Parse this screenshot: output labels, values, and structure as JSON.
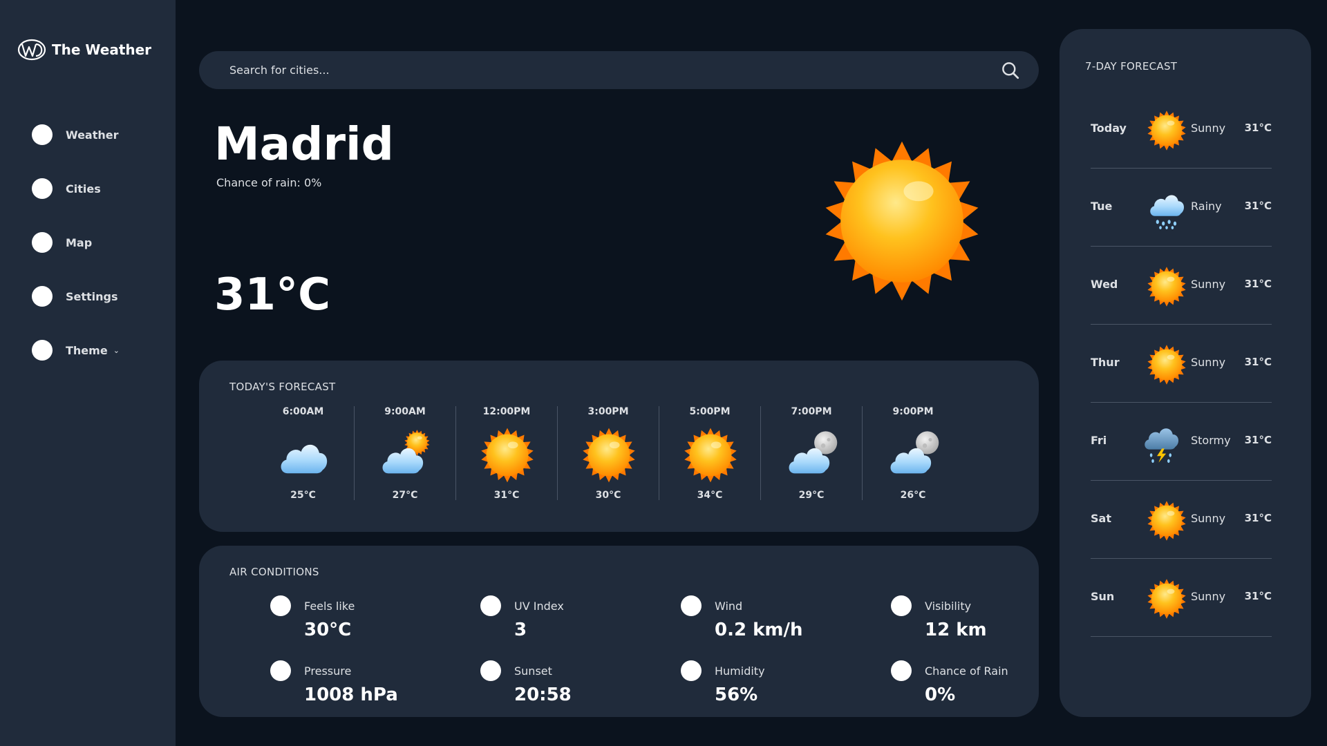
{
  "app": {
    "title": "The Weather",
    "logo_icon": "weather-logo-icon"
  },
  "sidebar": {
    "items": [
      {
        "label": "Weather"
      },
      {
        "label": "Cities"
      },
      {
        "label": "Map"
      },
      {
        "label": "Settings"
      },
      {
        "label": "Theme",
        "has_dropdown": true
      }
    ]
  },
  "search": {
    "placeholder": "Search for cities...",
    "value": ""
  },
  "current": {
    "city": "Madrid",
    "rain_chance": "Chance of rain: 0%",
    "temperature": "31°C",
    "icon": "sun-icon"
  },
  "today_forecast": {
    "title": "TODAY'S FORECAST",
    "hours": [
      {
        "time": "6:00AM",
        "temp": "25°C",
        "icon": "cloud-icon"
      },
      {
        "time": "9:00AM",
        "temp": "27°C",
        "icon": "partly-sunny-icon"
      },
      {
        "time": "12:00PM",
        "temp": "31°C",
        "icon": "sun-icon"
      },
      {
        "time": "3:00PM",
        "temp": "30°C",
        "icon": "sun-icon"
      },
      {
        "time": "5:00PM",
        "temp": "34°C",
        "icon": "sun-icon"
      },
      {
        "time": "7:00PM",
        "temp": "29°C",
        "icon": "cloud-moon-icon"
      },
      {
        "time": "9:00PM",
        "temp": "26°C",
        "icon": "cloud-moon-icon"
      }
    ]
  },
  "air_conditions": {
    "title": "AIR CONDITIONS",
    "metrics": [
      {
        "label": "Feels like",
        "value": "30°C"
      },
      {
        "label": "UV Index",
        "value": "3"
      },
      {
        "label": "Wind",
        "value": "0.2 km/h"
      },
      {
        "label": "Visibility",
        "value": "12 km"
      },
      {
        "label": "Pressure",
        "value": "1008 hPa"
      },
      {
        "label": "Sunset",
        "value": "20:58"
      },
      {
        "label": "Humidity",
        "value": "56%"
      },
      {
        "label": "Chance of Rain",
        "value": "0%"
      }
    ]
  },
  "week_forecast": {
    "title": "7-DAY FORECAST",
    "days": [
      {
        "day": "Today",
        "condition": "Sunny",
        "temp": "31°C",
        "icon": "sun-icon"
      },
      {
        "day": "Tue",
        "condition": "Rainy",
        "temp": "31°C",
        "icon": "rain-cloud-icon"
      },
      {
        "day": "Wed",
        "condition": "Sunny",
        "temp": "31°C",
        "icon": "sun-icon"
      },
      {
        "day": "Thur",
        "condition": "Sunny",
        "temp": "31°C",
        "icon": "sun-icon"
      },
      {
        "day": "Fri",
        "condition": "Stormy",
        "temp": "31°C",
        "icon": "storm-cloud-icon"
      },
      {
        "day": "Sat",
        "condition": "Sunny",
        "temp": "31°C",
        "icon": "sun-icon"
      },
      {
        "day": "Sun",
        "condition": "Sunny",
        "temp": "31°C",
        "icon": "sun-icon"
      }
    ]
  },
  "colors": {
    "background": "#0b131e",
    "panel": "#202b3b",
    "text": "#dde0e4",
    "divider": "#4a5566"
  }
}
